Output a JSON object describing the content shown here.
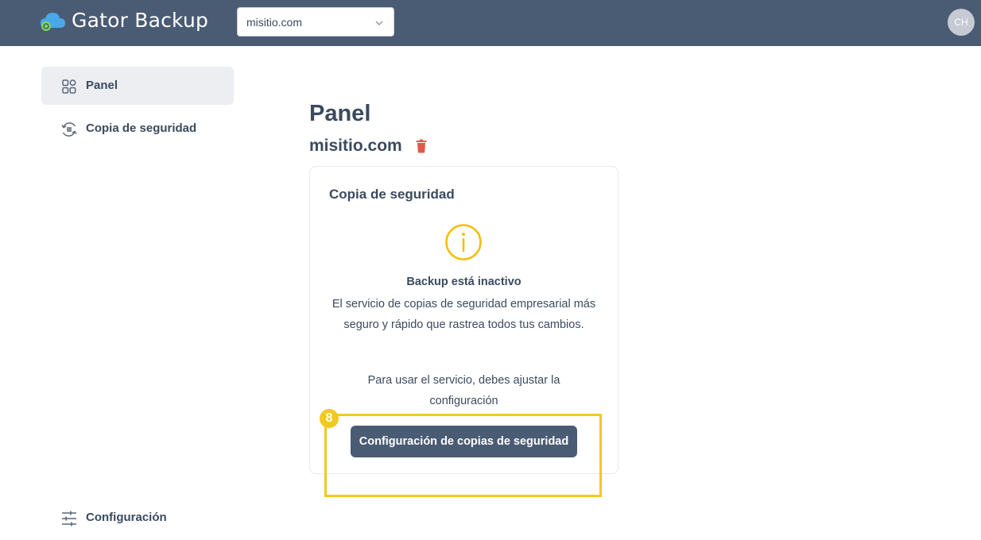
{
  "header": {
    "brand": "Gator Backup",
    "site_select": {
      "value": "misitio.com"
    },
    "avatar_initials": "CH",
    "colors": {
      "bar": "#4a5b74",
      "cloud": "#4aa8e8",
      "cloud_accent": "#7ed957"
    }
  },
  "sidebar": {
    "items": [
      {
        "label": "Panel",
        "icon": "dashboard-grid-icon",
        "active": true
      },
      {
        "label": "Copia de seguridad",
        "icon": "backup-sync-icon",
        "active": false
      },
      {
        "label": "Configuración",
        "icon": "sliders-settings-icon",
        "active": false
      }
    ]
  },
  "main": {
    "title": "Panel",
    "site_name": "misitio.com",
    "delete_icon": "trash-icon",
    "card": {
      "title": "Copia de seguridad",
      "icon": "info-circle-icon",
      "status": "Backup está inactivo",
      "description": "El servicio de copias de seguridad empresarial más seguro y rápido que rastrea todos tus cambios.",
      "instruction": "Para usar el servicio, debes ajustar la configuración",
      "button_label": "Configuración de copias de seguridad"
    }
  },
  "annotation": {
    "step_number": "8",
    "color": "#f2c91f"
  }
}
